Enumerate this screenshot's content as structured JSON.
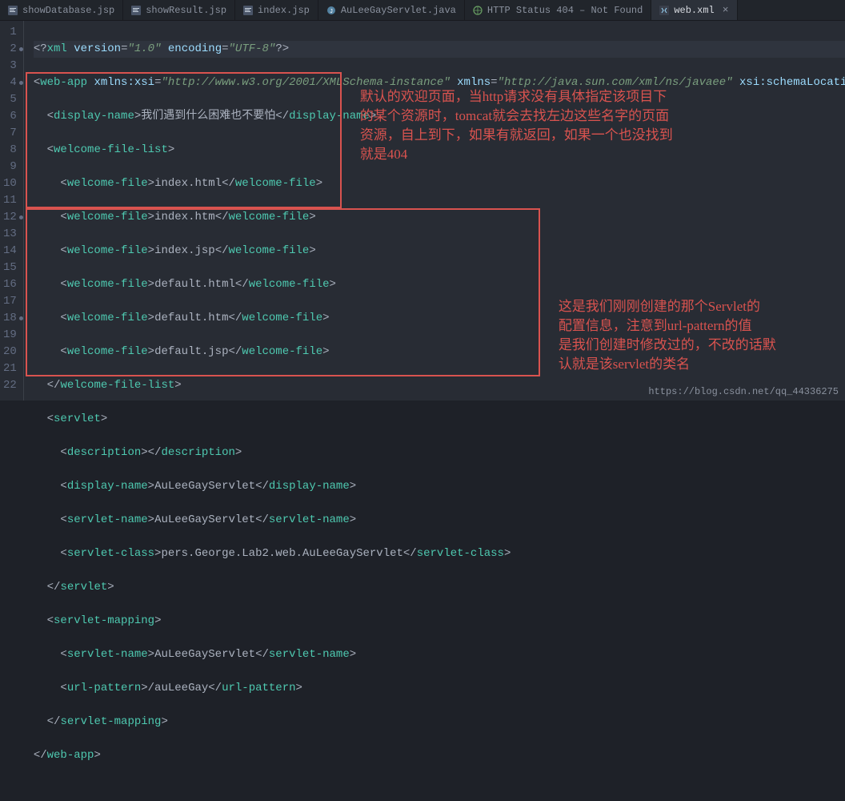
{
  "tabs": [
    {
      "icon": "jsp",
      "label": "showDatabase.jsp",
      "active": false
    },
    {
      "icon": "jsp",
      "label": "showResult.jsp",
      "active": false
    },
    {
      "icon": "jsp",
      "label": "index.jsp",
      "active": false
    },
    {
      "icon": "java",
      "label": "AuLeeGayServlet.java",
      "active": false
    },
    {
      "icon": "web",
      "label": "HTTP Status 404 – Not Found",
      "active": false
    },
    {
      "icon": "xml",
      "label": "web.xml",
      "active": true
    }
  ],
  "lines": {
    "count": 22,
    "fold_markers": [
      2,
      4,
      12,
      18
    ]
  },
  "code": {
    "l1": {
      "pi_open": "<?",
      "pi_name": "xml",
      "sp": " ",
      "a1n": "version",
      "eq": "=",
      "a1v": "\"1.0\"",
      "a2n": "encoding",
      "a2v": "\"UTF-8\"",
      "pi_close": "?>"
    },
    "l2": {
      "open": "<",
      "tag": "web-app",
      "sp": " ",
      "a1n": "xmlns:xsi",
      "eq": "=",
      "a1v": "\"http://www.w3.org/2001/XMLSchema-instance\"",
      "a2n": "xmlns",
      "a2v": "\"http://java.sun.com/xml/ns/javaee\"",
      "a3n": "xsi:schemaLocatio"
    },
    "l3": {
      "open": "<",
      "tag": "display-name",
      "c": ">",
      "txt": "我们遇到什么困难也不要怕",
      "co": "</",
      "cc": ">"
    },
    "l4": {
      "open": "<",
      "tag": "welcome-file-list",
      "c": ">"
    },
    "l5": {
      "open": "<",
      "tag": "welcome-file",
      "c": ">",
      "txt": "index.html",
      "co": "</",
      "cc": ">"
    },
    "l6": {
      "open": "<",
      "tag": "welcome-file",
      "c": ">",
      "txt": "index.htm",
      "co": "</",
      "cc": ">"
    },
    "l7": {
      "open": "<",
      "tag": "welcome-file",
      "c": ">",
      "txt": "index.jsp",
      "co": "</",
      "cc": ">"
    },
    "l8": {
      "open": "<",
      "tag": "welcome-file",
      "c": ">",
      "txt": "default.html",
      "co": "</",
      "cc": ">"
    },
    "l9": {
      "open": "<",
      "tag": "welcome-file",
      "c": ">",
      "txt": "default.htm",
      "co": "</",
      "cc": ">"
    },
    "l10": {
      "open": "<",
      "tag": "welcome-file",
      "c": ">",
      "txt": "default.jsp",
      "co": "</",
      "cc": ">"
    },
    "l11": {
      "co": "</",
      "tag": "welcome-file-list",
      "cc": ">"
    },
    "l12": {
      "open": "<",
      "tag": "servlet",
      "c": ">"
    },
    "l13": {
      "open": "<",
      "tag": "description",
      "c": ">",
      "co": "</",
      "cc": ">"
    },
    "l14": {
      "open": "<",
      "tag": "display-name",
      "c": ">",
      "txt": "AuLeeGayServlet",
      "co": "</",
      "cc": ">"
    },
    "l15": {
      "open": "<",
      "tag": "servlet-name",
      "c": ">",
      "txt": "AuLeeGayServlet",
      "co": "</",
      "cc": ">"
    },
    "l16": {
      "open": "<",
      "tag": "servlet-class",
      "c": ">",
      "txt": "pers.George.Lab2.web.AuLeeGayServlet",
      "co": "</",
      "cc": ">"
    },
    "l17": {
      "co": "</",
      "tag": "servlet",
      "cc": ">"
    },
    "l18": {
      "open": "<",
      "tag": "servlet-mapping",
      "c": ">"
    },
    "l19": {
      "open": "<",
      "tag": "servlet-name",
      "c": ">",
      "txt": "AuLeeGayServlet",
      "co": "</",
      "cc": ">"
    },
    "l20": {
      "open": "<",
      "tag": "url-pattern",
      "c": ">",
      "txt": "/auLeeGay",
      "co": "</",
      "cc": ">"
    },
    "l21": {
      "co": "</",
      "tag": "servlet-mapping",
      "cc": ">"
    },
    "l22": {
      "co": "</",
      "tag": "web-app",
      "cc": ">"
    }
  },
  "annot1": "默认的欢迎页面，当http请求没有具体指定该项目下\n的某个资源时，tomcat就会去找左边这些名字的页面\n资源，自上到下，如果有就返回，如果一个也没找到\n就是404",
  "annot2": "这是我们刚刚创建的那个Servlet的\n配置信息，注意到url-pattern的值\n是我们创建时修改过的，不改的话默\n认就是该servlet的类名",
  "watermark": "https://blog.csdn.net/qq_44336275"
}
